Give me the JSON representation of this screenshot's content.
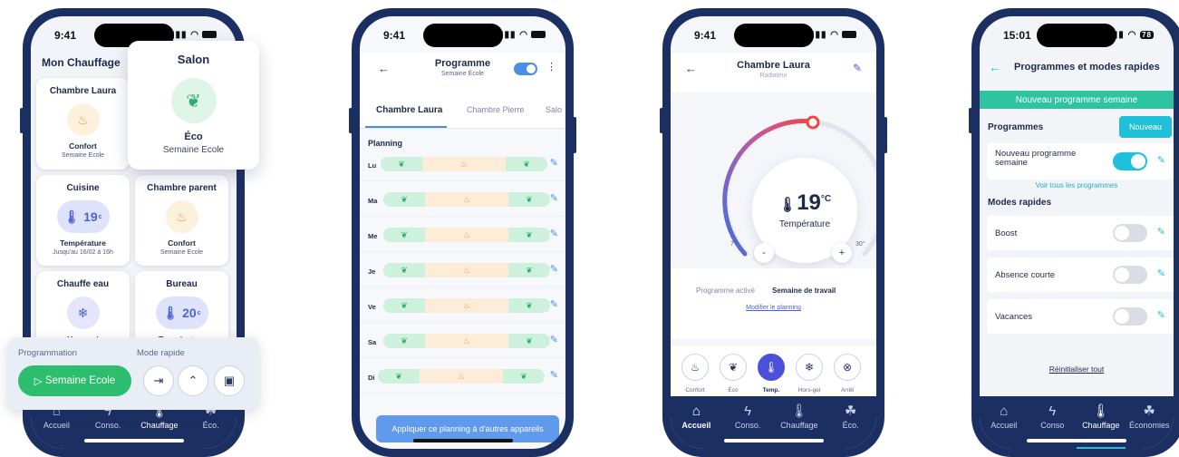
{
  "phone1": {
    "status_time": "9:41",
    "title": "Mon Chauffage",
    "cards": [
      {
        "name": "Chambre Laura",
        "mode": "Confort",
        "sub": "Semaine Ecole",
        "icon": "heat-icon"
      },
      {
        "name": "Cuisine",
        "mode": "Température",
        "sub": "Jusqu'au 16/02 à 16h",
        "temp": "19",
        "unit": "c"
      },
      {
        "name": "Chambre parent",
        "mode": "Confort",
        "sub": "Semaine Ecole",
        "icon": "heat-icon"
      },
      {
        "name": "Chauffe eau",
        "mode": "Hors-gel",
        "icon": "snowflake-icon"
      },
      {
        "name": "Bureau",
        "mode": "Température",
        "temp": "20",
        "unit": "c"
      }
    ],
    "popup": {
      "title": "Salon",
      "mode": "Éco",
      "sub": "Semaine Ecole",
      "icon": "leaf-icon"
    },
    "programmation": {
      "label": "Programmation",
      "mode_label": "Mode rapide",
      "button": "Semaine Ecole",
      "quick_icons": [
        "exit-icon",
        "boost-icon",
        "suitcase-icon"
      ]
    },
    "nav": [
      "Accueil",
      "Conso.",
      "Chauffage",
      "Éco."
    ]
  },
  "phone2": {
    "status_time": "9:41",
    "title": "Programme",
    "subtitle": "Semaine École",
    "tabs": [
      "Chambre Laura",
      "Chambre Pierre",
      "Salo"
    ],
    "planning_label": "Planning",
    "days": [
      "Lu",
      "Ma",
      "Me",
      "Je",
      "Ve",
      "Sa",
      "Di"
    ],
    "apply_button": "Appliquer ce planning à d'autres appareils"
  },
  "phone3": {
    "status_time": "9:41",
    "title": "Chambre Laura",
    "subtitle": "Radiateur",
    "temp": "19",
    "temp_unit": "°C",
    "temp_label": "Température",
    "min_label": "7°",
    "max_label": "30°",
    "minus": "-",
    "plus": "+",
    "prog_label": "Programme activé",
    "prog_value": "Semaine de travail",
    "modify_link": "Modifier le planning",
    "modes": [
      "Confort",
      "Éco",
      "Temp.",
      "Hors-gel",
      "Arrêt"
    ],
    "nav": [
      "Accueil",
      "Conso.",
      "Chauffage",
      "Éco."
    ]
  },
  "phone4": {
    "status_time": "15:01",
    "battery": "78",
    "title": "Programmes et modes rapides",
    "banner": "Nouveau programme semaine",
    "programmes_label": "Programmes",
    "nouveau_button": "Nouveau",
    "program_row": "Nouveau programme semaine",
    "see_all": "Voir tous les programmes",
    "modes_label": "Modes rapides",
    "modes": [
      "Boost",
      "Absence courte",
      "Vacances"
    ],
    "reset": "Réinitialiser tout",
    "nav": [
      "Accueil",
      "Conso",
      "Chauffage",
      "Économies"
    ]
  },
  "colors": {
    "navy": "#1c2f63",
    "green": "#2dbd6e",
    "blue": "#4b8ee8",
    "cyan": "#20c0d8",
    "orange": "#e9a243"
  }
}
